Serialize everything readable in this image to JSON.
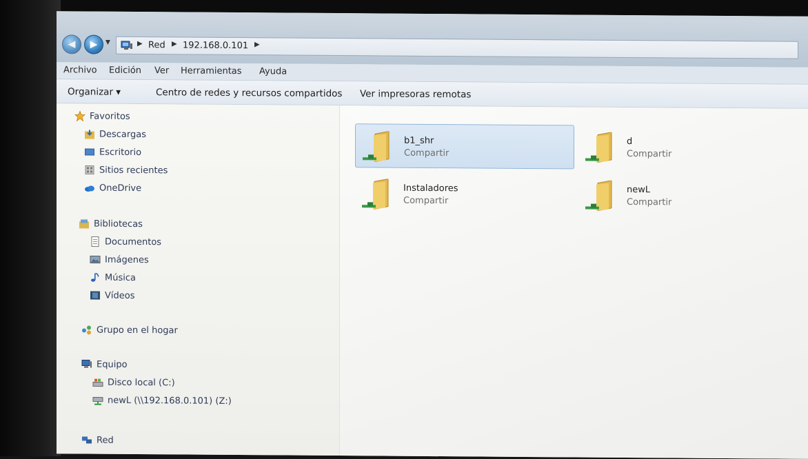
{
  "window": {
    "breadcrumb": [
      "Red",
      "192.168.0.101"
    ]
  },
  "menu": [
    "Archivo",
    "Edición",
    "Ver",
    "Herramientas",
    "Ayuda"
  ],
  "toolbar": {
    "organize": "Organizar ▾",
    "network_center": "Centro de redes y recursos compartidos",
    "remote_printers": "Ver impresoras remotas"
  },
  "sidebar": {
    "favorites": {
      "header": "Favoritos",
      "items": [
        "Descargas",
        "Escritorio",
        "Sitios recientes",
        "OneDrive"
      ]
    },
    "libraries": {
      "header": "Bibliotecas",
      "items": [
        "Documentos",
        "Imágenes",
        "Música",
        "Vídeos"
      ]
    },
    "homegroup": "Grupo en el hogar",
    "computer": {
      "header": "Equipo",
      "items": [
        "Disco local (C:)",
        "newL (\\\\192.168.0.101) (Z:)"
      ]
    },
    "network": "Red"
  },
  "shares": [
    {
      "name": "b1_shr",
      "type": "Compartir",
      "selected": true
    },
    {
      "name": "d",
      "type": "Compartir",
      "selected": false
    },
    {
      "name": "Instaladores",
      "type": "Compartir",
      "selected": false
    },
    {
      "name": "newL",
      "type": "Compartir",
      "selected": false
    }
  ],
  "colors": {
    "accent": "#3a86c6",
    "selection": "#cfe0f1",
    "folder": "#e6c15a"
  },
  "icons": {
    "back": "back-arrow-icon",
    "forward": "forward-arrow-icon",
    "share_folder": "network-share-folder-icon"
  }
}
